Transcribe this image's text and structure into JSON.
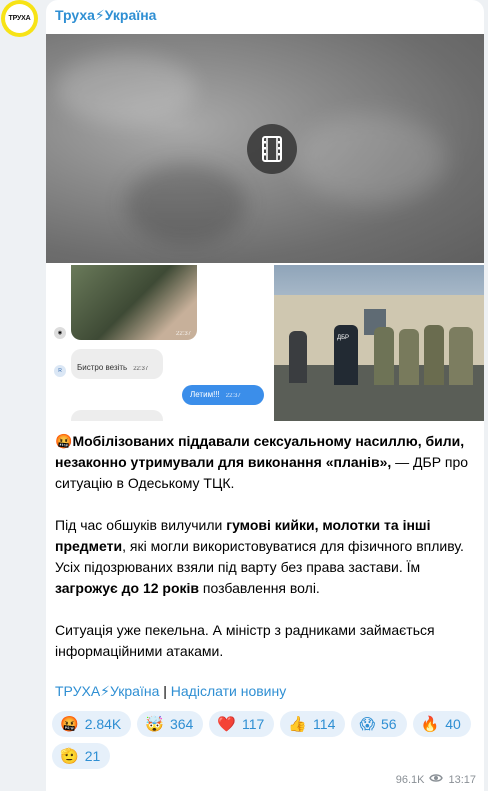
{
  "channel": {
    "name": "Труха⚡Україна",
    "avatar_text": "ТРУХА"
  },
  "media": {
    "video_icon": "film-icon",
    "chat_screenshot": {
      "messages": [
        {
          "text": "",
          "time": "22:37"
        },
        {
          "text": "Бистро везіть",
          "time": "22:37"
        },
        {
          "text": "Летим!!!",
          "time": "22:37"
        }
      ]
    },
    "photo_label": "ДБР"
  },
  "post": {
    "p1_emoji": "🤬",
    "p1_bold": "Мобілізованих піддавали сексуальному насиллю, били, незаконно утримували для виконання «планів»,",
    "p1_rest": " — ДБР про ситуацію в Одеському ТЦК.",
    "p2_a": "Під час обшуків вилучили ",
    "p2_b": "гумові кийки, молотки та інші предмети",
    "p2_c": ", які могли використовуватися для фізичного впливу. Усіх підозрюваних взяли під варту без права застави. Їм ",
    "p2_d": "загрожує до 12 років",
    "p2_e": " позбавлення волі.",
    "p3": "Ситуація уже пекельна. А міністр з радниками займається інформаційними атаками."
  },
  "links": {
    "channel_link": "ТРУХА⚡Україна",
    "separator": " | ",
    "submit_link": "Надіслати новину"
  },
  "reactions": [
    {
      "emoji": "🤬",
      "count": "2.84K"
    },
    {
      "emoji": "🤯",
      "count": "364"
    },
    {
      "emoji": "❤️",
      "count": "117"
    },
    {
      "emoji": "👍",
      "count": "114"
    },
    {
      "emoji": "😱",
      "count": "56"
    },
    {
      "emoji": "🔥",
      "count": "40"
    },
    {
      "emoji": "🫡",
      "count": "21"
    }
  ],
  "footer": {
    "views": "96.1K",
    "views_icon": "eye-icon",
    "time": "13:17"
  }
}
